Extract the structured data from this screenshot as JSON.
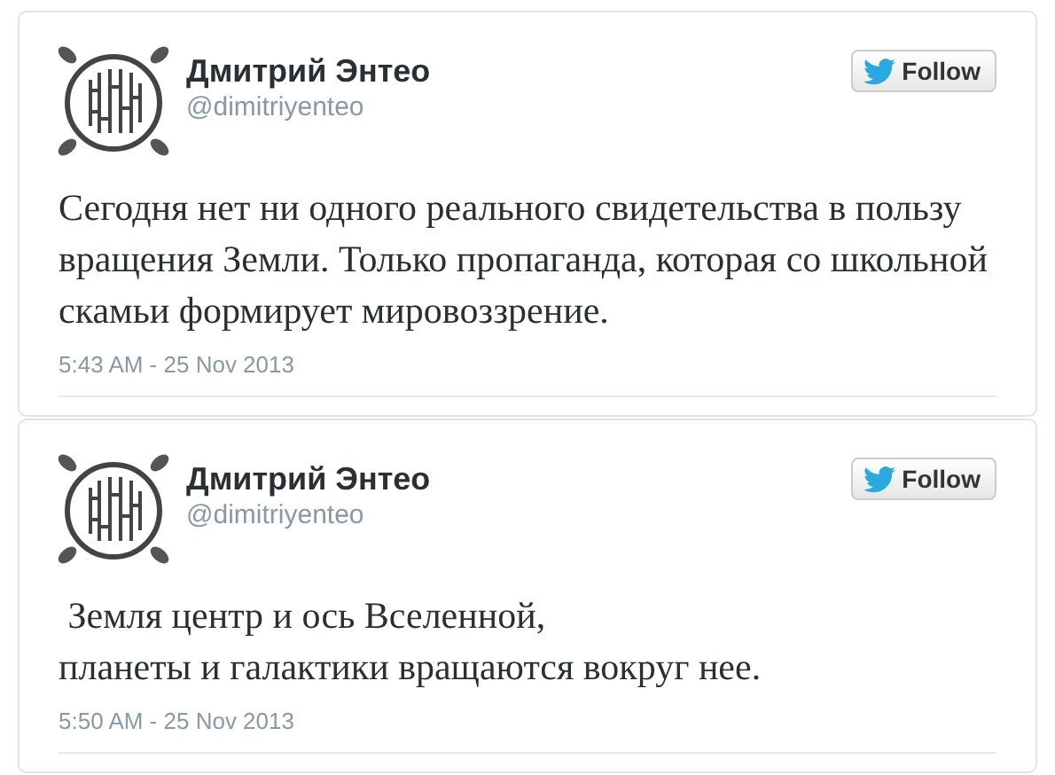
{
  "tweets": [
    {
      "name": "Дмитрий Энтео",
      "handle": "@dimitriyenteo",
      "follow": "Follow",
      "lines": [
        "Сегодня нет ни одного реального свидетельства в пользу вращения Земли. Только пропаганда, которая со школьной скамьи формирует мировоззрение."
      ],
      "time": "5:43 AM - 25 Nov 2013"
    },
    {
      "name": "Дмитрий Энтео",
      "handle": "@dimitriyenteo",
      "follow": "Follow",
      "lines": [
        " Земля центр и ось Вселенной,",
        "планеты и галактики вращаются вокруг нее."
      ],
      "time": "5:50 AM - 25 Nov 2013"
    }
  ]
}
